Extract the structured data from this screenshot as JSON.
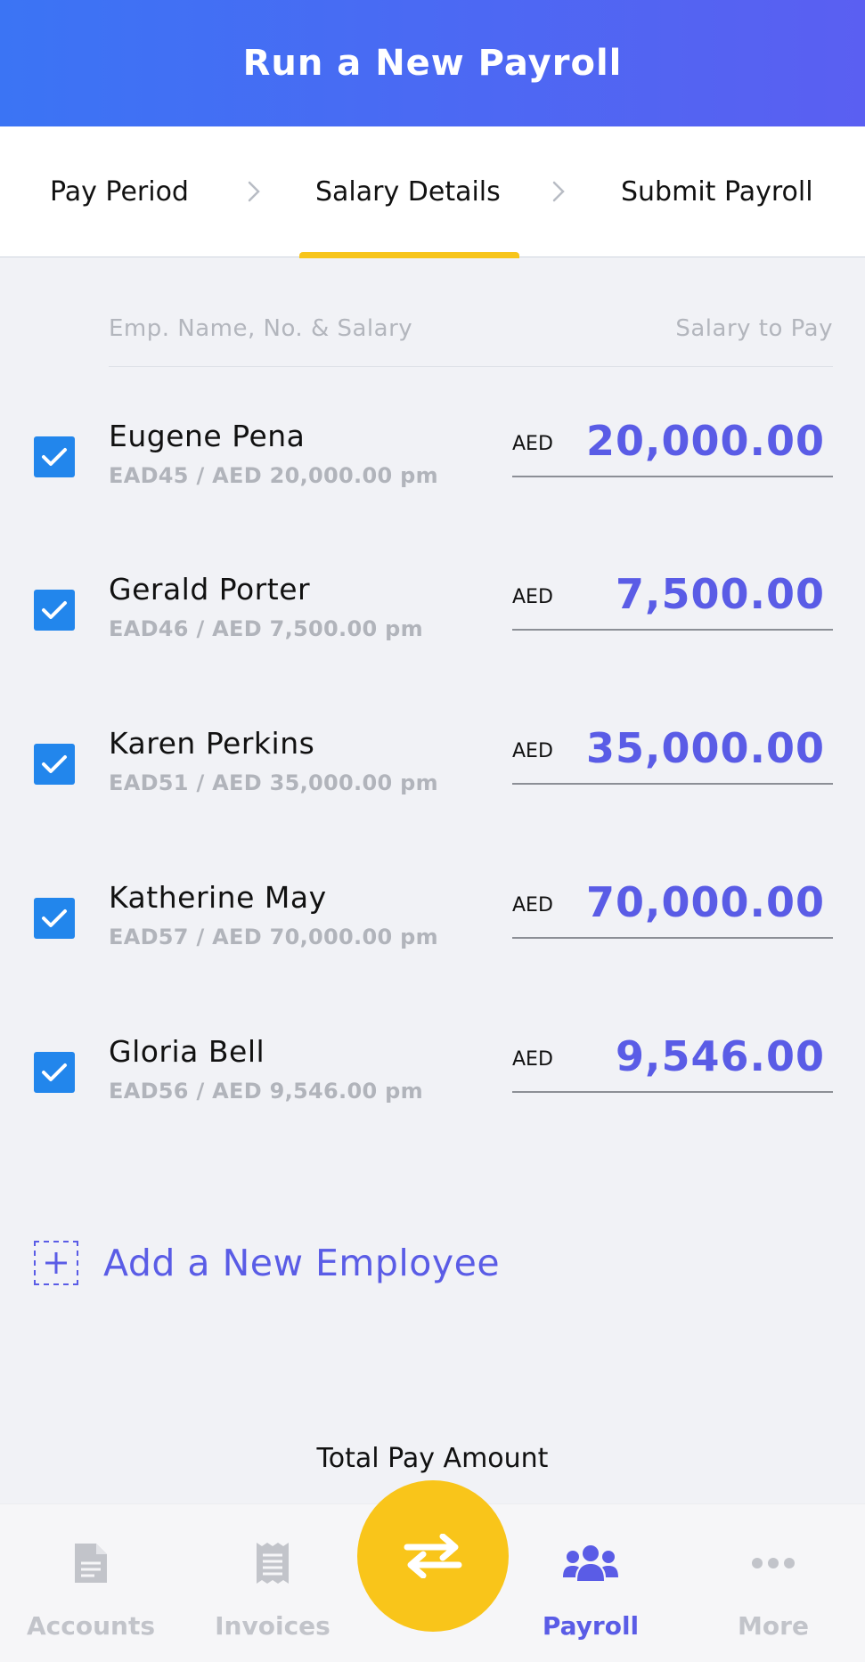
{
  "header": {
    "title": "Run a New Payroll"
  },
  "steps": [
    {
      "label": "Pay Period"
    },
    {
      "label": "Salary Details"
    },
    {
      "label": "Submit Payroll"
    }
  ],
  "active_step": "Salary Details",
  "columns": {
    "left": "Emp. Name, No. & Salary",
    "right": "Salary to Pay"
  },
  "employees": [
    {
      "name": "Eugene Pena",
      "sub": "EAD45 / AED 20,000.00 pm",
      "currency": "AED",
      "amount": "20,000.00",
      "checked": true
    },
    {
      "name": "Gerald Porter",
      "sub": "EAD46 / AED 7,500.00 pm",
      "currency": "AED",
      "amount": "7,500.00",
      "checked": true
    },
    {
      "name": "Karen Perkins",
      "sub": "EAD51 / AED 35,000.00 pm",
      "currency": "AED",
      "amount": "35,000.00",
      "checked": true
    },
    {
      "name": "Katherine May",
      "sub": "EAD57 / AED 70,000.00 pm",
      "currency": "AED",
      "amount": "70,000.00",
      "checked": true
    },
    {
      "name": "Gloria Bell",
      "sub": "EAD56 / AED 9,546.00 pm",
      "currency": "AED",
      "amount": "9,546.00",
      "checked": true
    }
  ],
  "add_employee": {
    "label": "Add a New Employee"
  },
  "total": {
    "label": "Total Pay Amount"
  },
  "tabbar": {
    "items": [
      {
        "label": "Accounts",
        "icon": "document-icon"
      },
      {
        "label": "Invoices",
        "icon": "receipt-icon"
      },
      {
        "label": "Payroll",
        "icon": "users-icon",
        "active": true
      },
      {
        "label": "More",
        "icon": "more-dots-icon"
      }
    ],
    "center_icon": "transfer-icon"
  },
  "colors": {
    "primary": "#5a5ce6",
    "header_start": "#3b74f4",
    "accent": "#f9c51a",
    "checkbox": "#2286ec"
  }
}
